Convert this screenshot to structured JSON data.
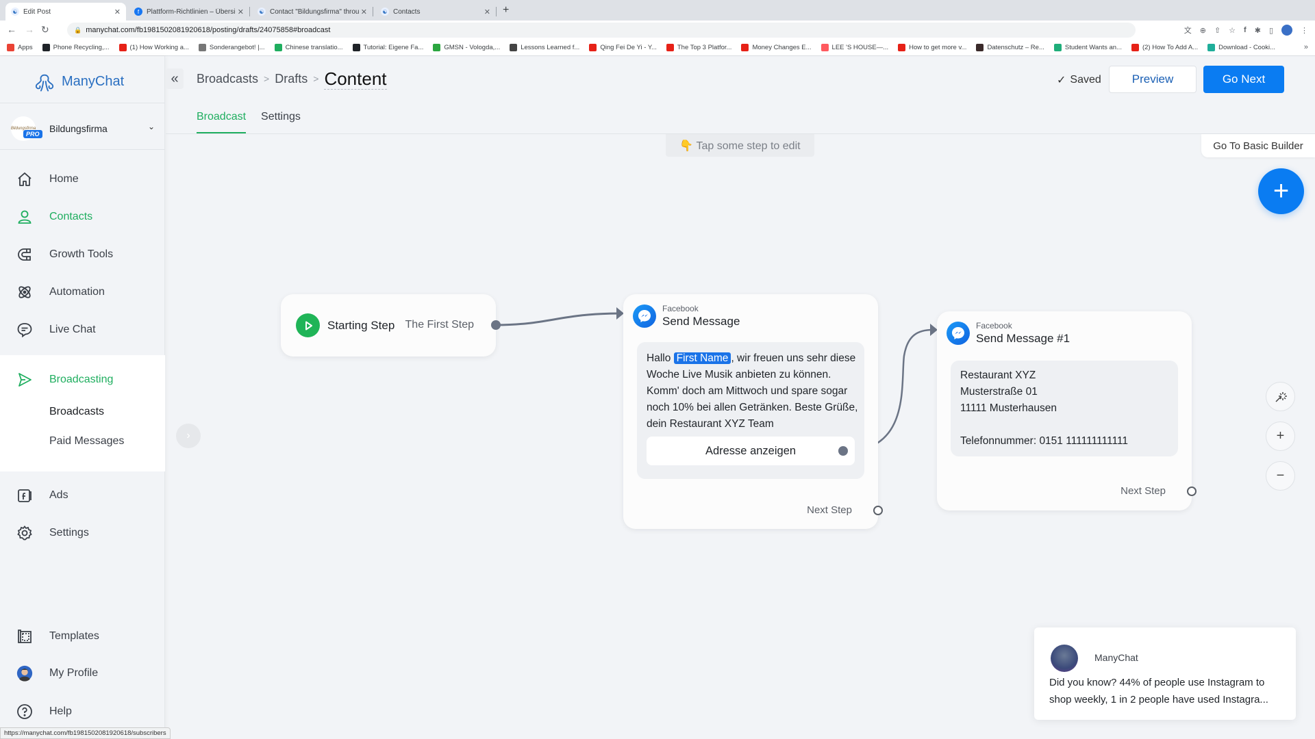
{
  "browser": {
    "tabs": [
      {
        "title": "Edit Post",
        "favicon": "manychat-icon",
        "active": true
      },
      {
        "title": "Plattform-Richtlinien – Übersic",
        "favicon": "facebook-icon",
        "active": false
      },
      {
        "title": "Contact \"Bildungsfirma\" throu",
        "favicon": "manychat-icon",
        "active": false
      },
      {
        "title": "Contacts",
        "favicon": "manychat-icon",
        "active": false
      }
    ],
    "url": "manychat.com/fb1981502081920618/posting/drafts/24075858#broadcast",
    "bookmarks": [
      {
        "label": "Apps",
        "color": "#ea4335"
      },
      {
        "label": "Phone Recycling,...",
        "color": "#1f2328"
      },
      {
        "label": "(1) How Working a...",
        "color": "#e62117"
      },
      {
        "label": "Sonderangebot! |...",
        "color": "#777777"
      },
      {
        "label": "Chinese translatio...",
        "color": "#1fae5f"
      },
      {
        "label": "Tutorial: Eigene Fa...",
        "color": "#1f2328"
      },
      {
        "label": "GMSN - Vologda,...",
        "color": "#2ba640"
      },
      {
        "label": "Lessons Learned f...",
        "color": "#444444"
      },
      {
        "label": "Qing Fei De Yi - Y...",
        "color": "#e62117"
      },
      {
        "label": "The Top 3 Platfor...",
        "color": "#e62117"
      },
      {
        "label": "Money Changes E...",
        "color": "#e62117"
      },
      {
        "label": "LEE 'S HOUSE—...",
        "color": "#ff5a5f"
      },
      {
        "label": "How to get more v...",
        "color": "#e62117"
      },
      {
        "label": "Datenschutz – Re...",
        "color": "#3a2a2a"
      },
      {
        "label": "Student Wants an...",
        "color": "#1fae7a"
      },
      {
        "label": "(2) How To Add A...",
        "color": "#e62117"
      },
      {
        "label": "Download - Cooki...",
        "color": "#1fae9a"
      }
    ],
    "bookmarks_more": "»",
    "status_url": "https://manychat.com/fb1981502081920618/subscribers"
  },
  "sidebar": {
    "brand": "ManyChat",
    "account": {
      "name": "Bildungsfirma",
      "badge": "PRO",
      "logo_text": "Bildungsfirma"
    },
    "items": [
      {
        "label": "Home",
        "icon": "home-icon"
      },
      {
        "label": "Contacts",
        "icon": "user-icon"
      },
      {
        "label": "Growth Tools",
        "icon": "magnet-icon"
      },
      {
        "label": "Automation",
        "icon": "atom-icon"
      },
      {
        "label": "Live Chat",
        "icon": "chat-bubble-icon"
      },
      {
        "label": "Broadcasting",
        "icon": "send-icon"
      },
      {
        "label": "Ads",
        "icon": "facebook-ads-icon"
      },
      {
        "label": "Settings",
        "icon": "gear-icon"
      },
      {
        "label": "Templates",
        "icon": "templates-icon"
      },
      {
        "label": "My Profile",
        "icon": "avatar"
      },
      {
        "label": "Help",
        "icon": "help-icon"
      }
    ],
    "broadcasting_sub": [
      {
        "label": "Broadcasts",
        "active": true
      },
      {
        "label": "Paid Messages",
        "active": false
      }
    ]
  },
  "header": {
    "breadcrumb": [
      "Broadcasts",
      "Drafts"
    ],
    "title": "Content",
    "saved_label": "Saved",
    "preview_label": "Preview",
    "go_next_label": "Go Next",
    "tabs": [
      {
        "label": "Broadcast",
        "active": true
      },
      {
        "label": "Settings",
        "active": false
      }
    ]
  },
  "canvas": {
    "hint": "👇 Tap some step to edit",
    "basic_builder_label": "Go To Basic Builder",
    "start_node": {
      "title": "Starting Step",
      "link_label": "The First Step"
    },
    "message_node_1": {
      "platform": "Facebook",
      "title": "Send Message",
      "text_before_var": "Hallo ",
      "variable": "First Name",
      "text_after_var": ", wir freuen uns sehr diese Woche Live Musik anbieten zu können. Komm' doch am Mittwoch und spare sogar noch 10% bei allen Getränken. Beste Grüße, dein Restaurant XYZ Team",
      "button_label": "Adresse anzeigen",
      "next_step_label": "Next Step"
    },
    "message_node_2": {
      "platform": "Facebook",
      "title": "Send Message #1",
      "lines": [
        "Restaurant XYZ",
        "Musterstraße 01",
        "11111 Musterhausen",
        "",
        "Telefonnummer: 0151 111111111111"
      ],
      "next_step_label": "Next Step"
    }
  },
  "notification": {
    "sender": "ManyChat",
    "text": "Did you know? 44% of people use Instagram to shop weekly, 1 in 2 people have used Instagra..."
  },
  "colors": {
    "accent_green": "#1fae5f",
    "primary_blue": "#0a7cf2",
    "brand_blue": "#2a6fc1"
  }
}
